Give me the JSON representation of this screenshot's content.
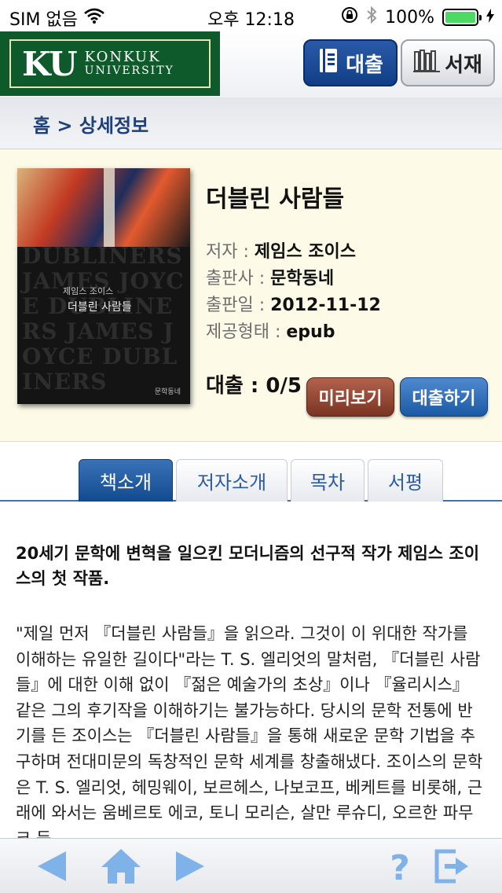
{
  "status_bar": {
    "carrier": "SIM 없음",
    "time": "오후 12:18",
    "battery": "100%",
    "battery_level": 1.0
  },
  "header": {
    "logo_mark": "KU",
    "logo_line1": "KONKUK",
    "logo_line2": "UNIVERSITY",
    "loan_button": "대출",
    "shelf_button": "서재"
  },
  "breadcrumb": "홈 > 상세정보",
  "book": {
    "cover": {
      "bg_text": "DUBLINERS JAMES JOYCE DUBLINERS JAMES JOYCE DUBLINERS",
      "subtitle": "제임스 조이스",
      "title": "더블린 사람들",
      "publisher_mark": "문학동네"
    },
    "title": "더블린 사람들",
    "author_label": "저자 : ",
    "author": "제임스 조이스",
    "publisher_label": "출판사 : ",
    "publisher": "문학동네",
    "pubdate_label": "출판일 : ",
    "pubdate": "2012-11-12",
    "format_label": "제공형태 : ",
    "format": "epub",
    "loan_status": "대출 : 0/5",
    "preview_button": "미리보기",
    "borrow_button": "대출하기"
  },
  "tabs": [
    {
      "label": "책소개",
      "active": true
    },
    {
      "label": "저자소개",
      "active": false
    },
    {
      "label": "목차",
      "active": false
    },
    {
      "label": "서평",
      "active": false
    }
  ],
  "content": {
    "headline": "20세기 문학에 변혁을 일으킨 모더니즘의 선구적 작가 제임스 조이스의 첫 작품.",
    "paragraph": "\"제일 먼저 『더블린 사람들』을 읽으라. 그것이 이 위대한 작가를 이해하는 유일한 길이다\"라는 T. S. 엘리엇의 말처럼, 『더블린 사람들』에 대한 이해 없이 『젊은 예술가의 초상』이나 『율리시스』 같은 그의 후기작을 이해하기는 불가능하다. 당시의 문학 전통에 반기를 든 조이스는 『더블린 사람들』을 통해 새로운 문학 기법을 추구하며 전대미문의 독창적인 문학 세계를 창출해냈다. 조이스의 문학은 T. S. 엘리엇, 헤밍웨이, 보르헤스, 나보코프, 베케트를 비롯해, 근래에 와서는 움베르토 에코, 토니 모리슨, 살만 루슈디, 오르한 파무크 등"
  },
  "colors": {
    "brand_green": "#0f5a2b",
    "brand_blue": "#1c5aa5",
    "preview_brown": "#7a3423",
    "icon_blue": "#4f8fd6"
  }
}
